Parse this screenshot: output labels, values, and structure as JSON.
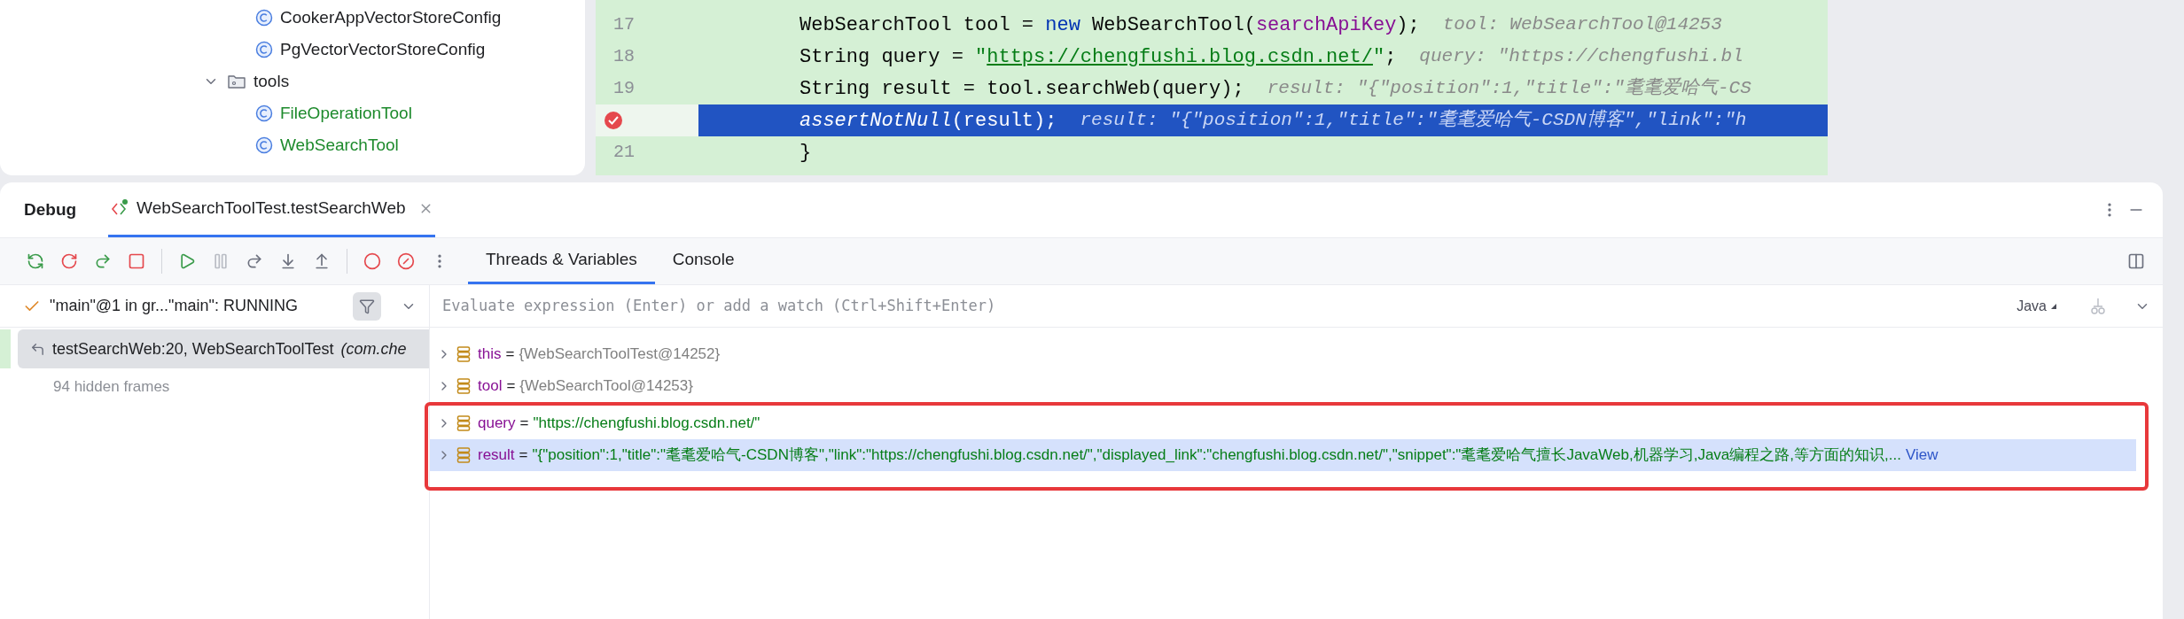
{
  "project_tree": {
    "nodes": [
      {
        "kind": "folder_tail",
        "children": [
          {
            "kind": "class",
            "label": "CookerAppVectorStoreConfig",
            "added": false
          },
          {
            "kind": "class",
            "label": "PgVectorVectorStoreConfig",
            "added": false
          }
        ]
      },
      {
        "kind": "folder",
        "label": "tools",
        "expanded": true,
        "children": [
          {
            "kind": "class",
            "label": "FileOperationTool",
            "added": true
          },
          {
            "kind": "class",
            "label": "WebSearchTool",
            "added": true
          }
        ]
      }
    ]
  },
  "editor": {
    "lines": [
      {
        "number": "17",
        "current": false,
        "breakpoint": false,
        "tokens": [
          {
            "kind": "plain",
            "text": "WebSearchTool tool = "
          },
          {
            "kind": "keyword",
            "text": "new"
          },
          {
            "kind": "plain",
            "text": " WebSearchTool("
          },
          {
            "kind": "field",
            "text": "searchApiKey"
          },
          {
            "kind": "plain",
            "text": ");"
          }
        ],
        "hint": "tool: WebSearchTool@14253"
      },
      {
        "number": "18",
        "current": false,
        "breakpoint": false,
        "tokens": [
          {
            "kind": "plain",
            "text": "String query = "
          },
          {
            "kind": "string",
            "text": "\""
          },
          {
            "kind": "link",
            "text": "https://chengfushi.blog.csdn.net/"
          },
          {
            "kind": "string",
            "text": "\""
          },
          {
            "kind": "plain",
            "text": ";"
          }
        ],
        "hint": "query: \"https://chengfushi.bl"
      },
      {
        "number": "19",
        "current": false,
        "breakpoint": false,
        "tokens": [
          {
            "kind": "plain",
            "text": "String result = tool.searchWeb(query);"
          }
        ],
        "hint": "result: \"{\"position\":1,\"title\":\"耄耄爱哈气-CS"
      },
      {
        "current": true,
        "breakpoint": true,
        "tokens": [
          {
            "kind": "static",
            "text": "assertNotNull"
          },
          {
            "kind": "plain",
            "text": "(result);"
          }
        ],
        "hint": "result: \"{\"position\":1,\"title\":\"耄耄爱哈气-CSDN博客\",\"link\":\"h"
      },
      {
        "number": "21",
        "current": false,
        "breakpoint": false,
        "tokens": [
          {
            "kind": "plain",
            "text": "}"
          }
        ]
      }
    ]
  },
  "debug": {
    "title": "Debug",
    "tabs": [
      {
        "label": "WebSearchToolTest.testSearchWeb",
        "selected": true
      }
    ],
    "subtabs": [
      {
        "label": "Threads & Variables",
        "selected": true
      },
      {
        "label": "Console",
        "selected": false
      }
    ],
    "thread": "\"main\"@1 in gr...\"main\": RUNNING",
    "frames": [
      {
        "label": "testSearchWeb:20, WebSearchToolTest",
        "package": "(com.che",
        "selected": true
      }
    ],
    "hidden_frames": "94 hidden frames",
    "evaluate": {
      "placeholder": "Evaluate expression (Enter) or add a watch (Ctrl+Shift+Enter)",
      "language": "Java"
    },
    "variables": [
      {
        "name": "this",
        "sign": "=",
        "value": "{WebSearchToolTest@14252}",
        "kind": "object",
        "selected": false,
        "boxed": false
      },
      {
        "name": "tool",
        "sign": "=",
        "value": "{WebSearchTool@14253}",
        "kind": "object",
        "selected": false,
        "boxed": false
      },
      {
        "name": "query",
        "sign": "=",
        "value": "\"https://chengfushi.blog.csdn.net/\"",
        "kind": "string",
        "selected": false,
        "boxed": true
      },
      {
        "name": "result",
        "sign": "=",
        "value": "\"{\"position\":1,\"title\":\"耄耄爱哈气-CSDN博客\",\"link\":\"https://chengfushi.blog.csdn.net/\",\"displayed_link\":\"chengfushi.blog.csdn.net/\",\"snippet\":\"耄耄爱哈气擅长JavaWeb,机器学习,Java编程之路,等方面的知识,...",
        "kind": "string",
        "selected": true,
        "boxed": true,
        "more": "View"
      }
    ]
  }
}
